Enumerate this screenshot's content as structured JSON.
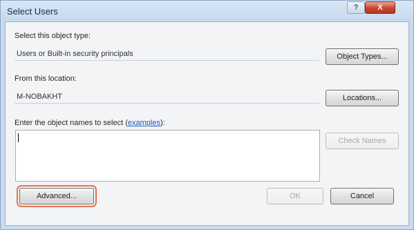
{
  "window": {
    "title": "Select Users",
    "help_glyph": "?",
    "close_glyph": "X"
  },
  "object_type": {
    "label": "Select this object type:",
    "value": "Users or Built-in security principals",
    "button_label": "Object Types..."
  },
  "location": {
    "label": "From this location:",
    "value": "M-NOBAKHT",
    "button_label": "Locations..."
  },
  "names": {
    "label_prefix": "Enter the object names to select (",
    "label_link": "examples",
    "label_suffix": "):",
    "value": "",
    "check_names_label": "Check Names"
  },
  "footer": {
    "advanced_label": "Advanced...",
    "ok_label": "OK",
    "cancel_label": "Cancel"
  },
  "colors": {
    "highlight_outline": "#e1734f",
    "close_button": "#c8452f",
    "link": "#1f58b8"
  }
}
